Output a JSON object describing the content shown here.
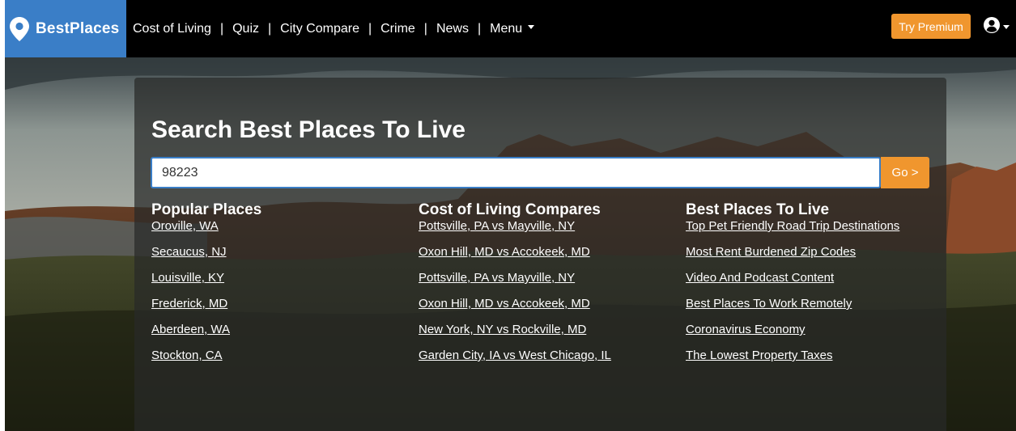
{
  "brand": {
    "name": "BestPlaces",
    "color": "#3a7ec7"
  },
  "nav": {
    "items": [
      "Cost of Living",
      "Quiz",
      "City Compare",
      "Crime",
      "News"
    ],
    "menu_label": "Menu",
    "separator": "|"
  },
  "premium": {
    "label": "Try Premium",
    "color": "#f0962e"
  },
  "search": {
    "title": "Search Best Places To Live",
    "value": "98223",
    "go_label": "Go >"
  },
  "columns": [
    {
      "heading": "Popular Places",
      "links": [
        "Oroville, WA",
        "Secaucus, NJ",
        "Louisville, KY",
        "Frederick, MD",
        "Aberdeen, WA",
        "Stockton, CA"
      ]
    },
    {
      "heading": "Cost of Living Compares",
      "links": [
        "Pottsville, PA vs Mayville, NY",
        "Oxon Hill, MD vs Accokeek, MD",
        "Pottsville, PA vs Mayville, NY",
        "Oxon Hill, MD vs Accokeek, MD",
        "New York, NY vs Rockville, MD",
        "Garden City, IA vs West Chicago, IL"
      ]
    },
    {
      "heading": "Best Places To Live",
      "links": [
        "Top Pet Friendly Road Trip Destinations",
        "Most Rent Burdened Zip Codes",
        "Video And Podcast Content",
        "Best Places To Work Remotely",
        "Coronavirus Economy",
        "The Lowest Property Taxes"
      ]
    }
  ],
  "icons": {
    "brand": "map-pin-icon",
    "user": "user-circle-icon",
    "dropdown": "caret-down-icon"
  }
}
